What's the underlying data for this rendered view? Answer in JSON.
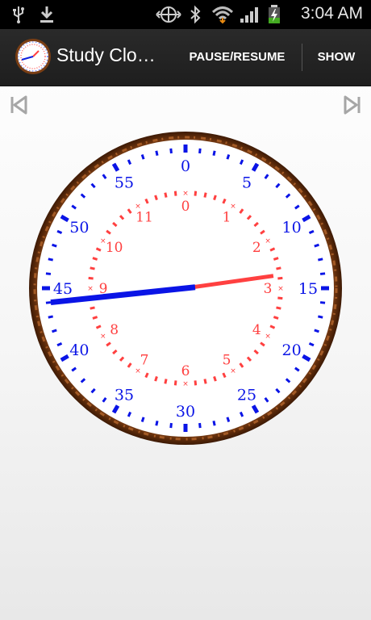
{
  "status_bar": {
    "time": "3:04 AM",
    "icons": [
      "usb-icon",
      "download-icon",
      "sync-icon",
      "bluetooth-icon",
      "wifi-icon",
      "signal-icon",
      "battery-charging-icon"
    ]
  },
  "action_bar": {
    "title": "Study Clo…",
    "pause_resume_label": "PAUSE/RESUME",
    "show_label": "SHOW"
  },
  "nav": {
    "prev_icon": "skip-previous-icon",
    "next_icon": "skip-next-icon"
  },
  "clock": {
    "hour_labels": [
      "0",
      "1",
      "2",
      "3",
      "4",
      "5",
      "6",
      "7",
      "8",
      "9",
      "10",
      "11"
    ],
    "minute_labels": [
      "0",
      "5",
      "10",
      "15",
      "20",
      "25",
      "30",
      "35",
      "40",
      "45",
      "50",
      "55"
    ],
    "time_shown": {
      "hours": 2,
      "minutes": 44
    },
    "colors": {
      "hour": "#ff4040",
      "minute": "#0a14e6",
      "frame": "#6a3310"
    }
  }
}
